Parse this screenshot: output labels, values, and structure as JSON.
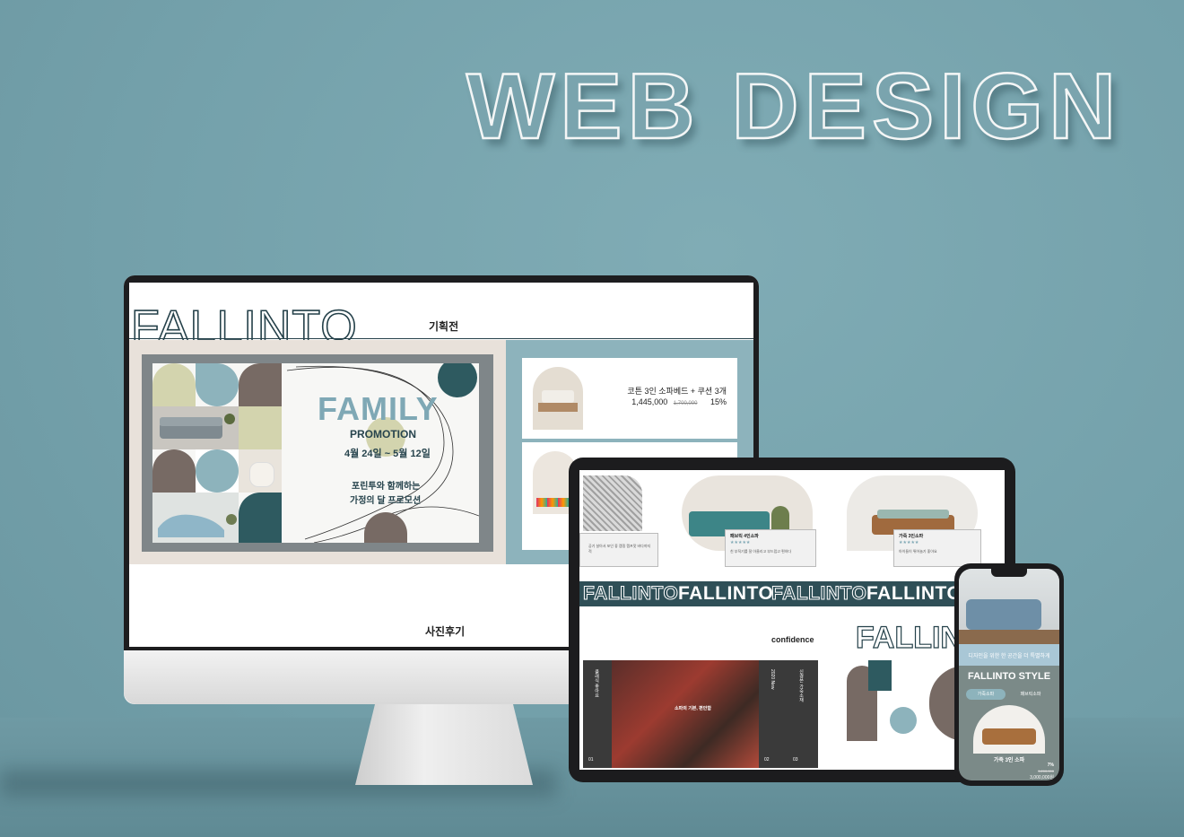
{
  "hero_title": "WEB DESIGN",
  "colors": {
    "background": "#76a3ad",
    "dark_teal": "#2f4f57",
    "light_blue": "#8db3bc",
    "sage": "#d3d4ae",
    "brown": "#776a64",
    "teal": "#2e5a60"
  },
  "monitor": {
    "brand": "FALLINTO",
    "nav_center": "기획전",
    "promo": {
      "headline": "FAMILY",
      "title": "PROMOTION",
      "dates": "4월 24일 ~ 5월 12일",
      "subtitle_1": "포린투와 함께하는",
      "subtitle_2": "가정의 달 프로모션"
    },
    "product": {
      "name": "코튼 3인 소파베드 + 쿠션 3개",
      "price": "1,445,000",
      "original_price": "1,700,000",
      "discount": "15%"
    },
    "section_label": "사진후기"
  },
  "tablet": {
    "cards": [
      {
        "title": "",
        "desc": "공기 살아서 포인 좋 캠핑 캠프맛 바다까지 적"
      },
      {
        "title": "패브릭 4인소파",
        "desc": "친 부직기를 잘 아울리고 부드럽고 편하다"
      },
      {
        "title": "가죽 3인소파",
        "desc": "아이들이 뛰어놀기 좋아요"
      }
    ],
    "band_items": [
      "FALLINTO",
      "FALLINTO",
      "FALLINTO",
      "FALLINTO"
    ],
    "section_label": "confidence",
    "outline_logo": "FALLIN",
    "photo": {
      "caption": "소파의 기본, 편안함",
      "col_1": "클래식 좋아요",
      "col_2": "2020 New",
      "col_3": "신경쓴 가죽소재",
      "num_1": "01",
      "num_2": "02",
      "num_3": "03"
    }
  },
  "phone": {
    "banner_text": "디자인을 위한 한 공간을 더 특별하게",
    "title": "FALLINTO STYLE",
    "tabs": [
      "가죽소파",
      "패브릭소파"
    ],
    "product_name": "가죽 3인 소파",
    "discount": "7%",
    "original_price": "3,200,000",
    "price": "3,000,000원"
  }
}
